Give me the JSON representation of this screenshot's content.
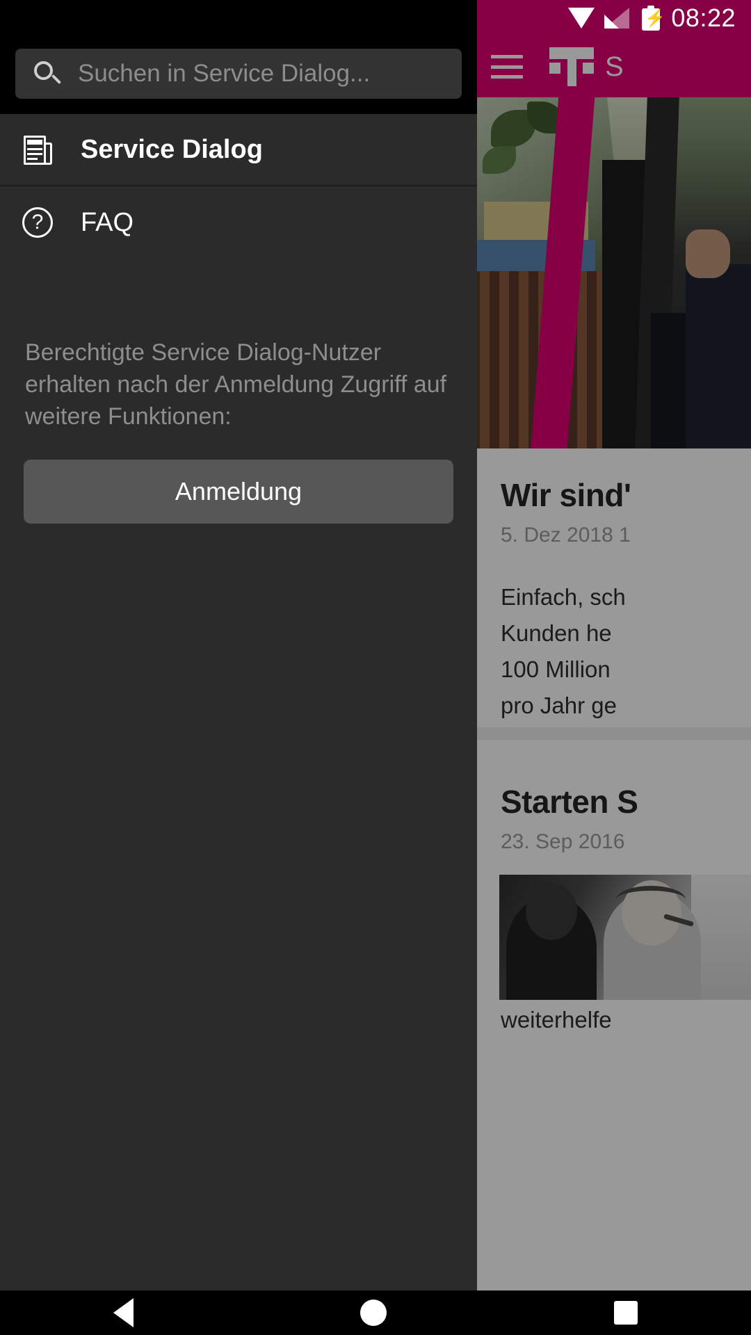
{
  "status_bar": {
    "time": "08:22",
    "wifi_icon": "wifi-icon",
    "signal_icon": "cellular-signal-icon",
    "battery_icon": "battery-charging-icon"
  },
  "app": {
    "brand_color": "#E20074",
    "header": {
      "menu_icon": "hamburger-menu-icon",
      "logo": "telekom-t-logo",
      "title": "S"
    },
    "articles": [
      {
        "title": "Wir sind'",
        "date": "5. Dez 2018 1",
        "body_lines": [
          "Einfach, sch",
          "Kunden he",
          "100 Million",
          "pro Jahr ge"
        ]
      },
      {
        "title": "Starten S",
        "date": "23. Sep 2016",
        "body_lines": [
          "weiterhelfe"
        ]
      }
    ]
  },
  "drawer": {
    "search": {
      "placeholder": "Suchen in Service Dialog...",
      "value": "",
      "icon": "search-icon"
    },
    "items": [
      {
        "label": "Service Dialog",
        "icon": "newspaper-icon",
        "selected": true
      },
      {
        "label": "FAQ",
        "icon": "question-circle-icon",
        "selected": false
      }
    ],
    "note": "Berechtigte Service Dialog-Nutzer erhalten nach der Anmeldung Zugriff auf weitere Funktionen:",
    "login_button": "Anmeldung"
  },
  "nav_bar": {
    "back": "back-button",
    "home": "home-button",
    "recents": "recents-button"
  }
}
